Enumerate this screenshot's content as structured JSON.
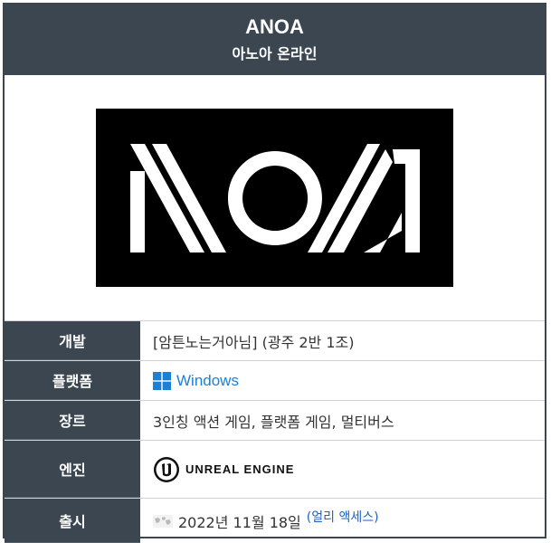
{
  "header": {
    "title": "ANOA",
    "subtitle": "아노아 온라인"
  },
  "logo": {
    "wordmark": "ANOA",
    "background": "#000000",
    "foreground": "#ffffff"
  },
  "rows": [
    {
      "label": "개발",
      "value": "[암튼노는거아님] (광주 2반 1조)"
    },
    {
      "label": "플랫폼",
      "value": "Windows"
    },
    {
      "label": "장르",
      "value": "3인칭 액션 게임, 플랫폼 게임, 멀티버스"
    },
    {
      "label": "엔진",
      "value": "UNREAL ENGINE"
    },
    {
      "label": "출시",
      "value": "2022년 11월 18일",
      "note": "(얼리 액세스)"
    }
  ],
  "icons": {
    "platform": "windows-logo-icon",
    "engine": "unreal-engine-logo-icon",
    "release": "globe-icon"
  },
  "colors": {
    "header_bg": "#3b4650",
    "link": "#1a62c9",
    "windows_blue": "#1b80d8"
  }
}
